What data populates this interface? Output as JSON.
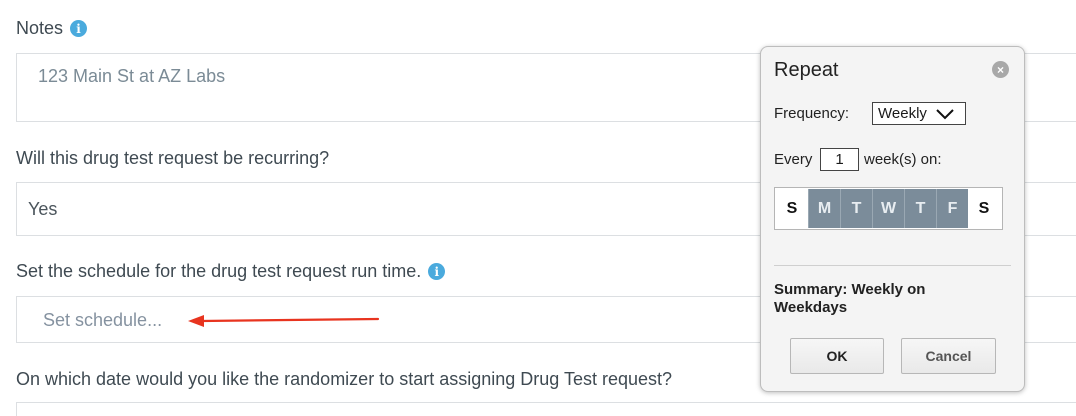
{
  "form": {
    "notes_label": "Notes",
    "notes_value": "123 Main St at AZ Labs",
    "recurring_question": "Will this drug test request be recurring?",
    "recurring_value": "Yes",
    "schedule_label": "Set the schedule for the drug test request run time.",
    "schedule_placeholder": "Set schedule...",
    "start_date_question": "On which date would you like the randomizer to start assigning Drug Test request?"
  },
  "icons": {
    "info": "info-icon",
    "close": "close-circle-icon",
    "dropdown": "chevron-down-icon",
    "arrow": "red-arrow-annotation"
  },
  "colors": {
    "info_icon": "#4aaadd",
    "annotation_arrow": "#e8341f",
    "selected_day": "#7b8c9a"
  },
  "repeat_dialog": {
    "title": "Repeat",
    "close_glyph": "×",
    "frequency_label": "Frequency:",
    "frequency_value": "Weekly",
    "every_label": "Every",
    "every_value": "1",
    "every_suffix": "week(s) on:",
    "days": [
      {
        "label": "S",
        "selected": false
      },
      {
        "label": "M",
        "selected": true
      },
      {
        "label": "T",
        "selected": true
      },
      {
        "label": "W",
        "selected": true
      },
      {
        "label": "T",
        "selected": true
      },
      {
        "label": "F",
        "selected": true
      },
      {
        "label": "S",
        "selected": false
      }
    ],
    "summary": "Summary: Weekly on Weekdays",
    "ok_label": "OK",
    "cancel_label": "Cancel"
  }
}
